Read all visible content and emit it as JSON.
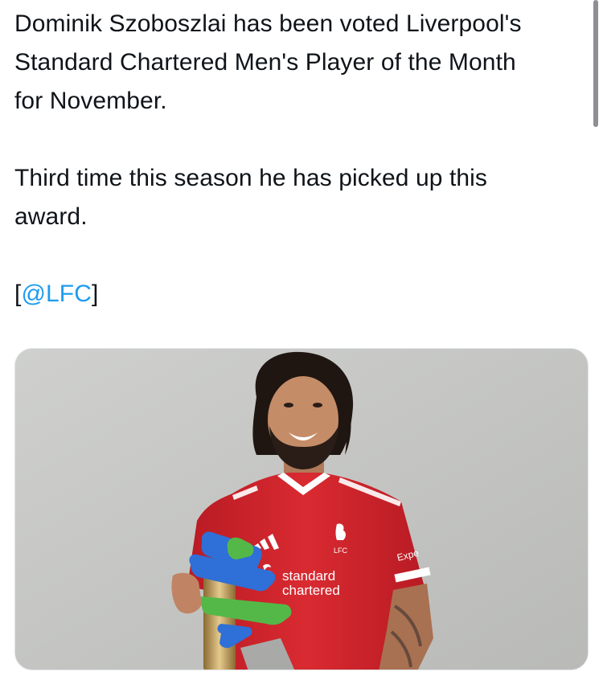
{
  "tweet": {
    "line1": "Dominik Szoboszlai has been voted Liverpool's",
    "line2": "Standard Chartered Men's Player of the Month",
    "line3": "for November.",
    "line4": "Third time this season he has picked up this",
    "line5": "award.",
    "mention_open": "[",
    "mention_handle": "@LFC",
    "mention_close": "]"
  },
  "media": {
    "kit_crest_text": "LFC",
    "sponsor_line1": "standard",
    "sponsor_line2": "chartered",
    "sleeve_sponsor": "Expe",
    "colors": {
      "wall": "#c8c9c7",
      "shirt": "#d3242c",
      "trophy_blue": "#2f6fd8",
      "trophy_green": "#54b848",
      "trophy_gold": "#c9a45c",
      "mention": "#1d9bf0"
    },
    "icons": [
      "liverbird-icon",
      "adidas-logo-icon",
      "standard-chartered-logo-icon"
    ]
  }
}
